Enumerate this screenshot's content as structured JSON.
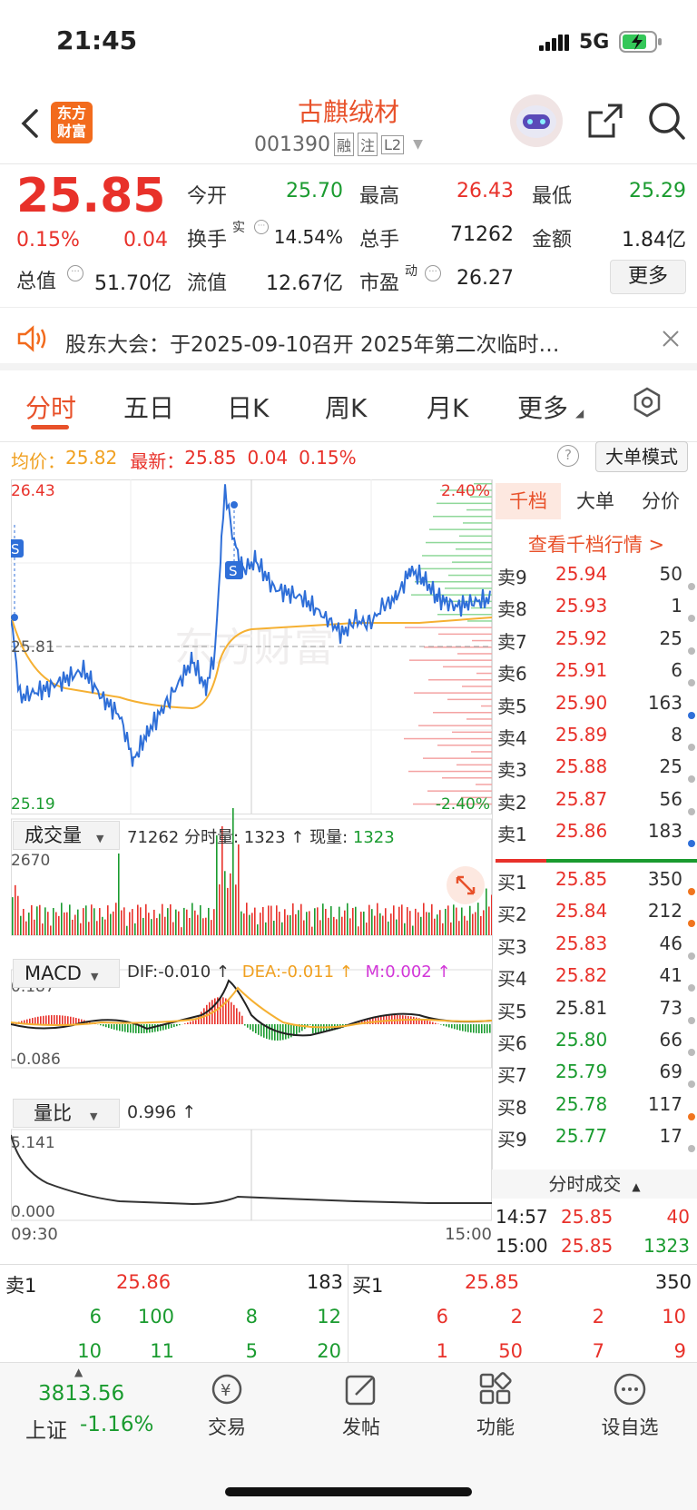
{
  "status": {
    "time": "21:45",
    "network": "5G"
  },
  "header": {
    "title": "古麒绒材",
    "code": "001390",
    "tags": [
      "融",
      "注",
      "L2"
    ],
    "logo_line1": "东方",
    "logo_line2": "财富"
  },
  "quote": {
    "price": "25.85",
    "pct": "0.15%",
    "change": "0.04",
    "open_label": "今开",
    "open": "25.70",
    "high_label": "最高",
    "high": "26.43",
    "low_label": "最低",
    "low": "25.29",
    "turnover_label": "换手",
    "turnover_sup": "实",
    "turnover": "14.54%",
    "volume_label": "总手",
    "volume": "71262",
    "amount_label": "金额",
    "amount": "1.84亿",
    "mktcap_label": "总值",
    "mktcap": "51.70亿",
    "float_label": "流值",
    "float": "12.67亿",
    "pe_label": "市盈",
    "pe_sup": "动",
    "pe": "26.27",
    "more": "更多"
  },
  "notice": {
    "text": "股东大会：于2025-09-10召开 2025年第二次临时…"
  },
  "tabs": [
    "分时",
    "五日",
    "日K",
    "周K",
    "月K",
    "更多"
  ],
  "info": {
    "avg_label": "均价：",
    "avg": "25.82",
    "last_label": "最新：",
    "last": "25.85",
    "chg": "0.04",
    "pct": "0.15%",
    "mode": "大单模式"
  },
  "chart": {
    "y_top": "26.43",
    "y_mid": "25.81",
    "y_bot": "25.19",
    "pct_top": "2.40%",
    "pct_bot": "-2.40%",
    "watermark": "东方财富",
    "s_mark": "S"
  },
  "volume": {
    "label": "成交量",
    "text1": "71262 分时量: 1323 ↑ 现量:",
    "now": "1323",
    "max": "2670"
  },
  "macd": {
    "label": "MACD",
    "dif": "DIF:-0.010 ↑",
    "dea": "DEA:-0.011 ↑",
    "m": "M:0.002 ↑",
    "top": "0.187",
    "bot": "-0.086"
  },
  "ratio": {
    "label": "量比",
    "value": "0.996 ↑",
    "top": "5.141",
    "bot": "0.000"
  },
  "time_axis": {
    "start": "09:30",
    "end": "15:00"
  },
  "depth_tabs": [
    "千档",
    "大单",
    "分价"
  ],
  "depth_link": "查看千档行情 >",
  "asks": [
    {
      "label": "卖9",
      "price": "25.94",
      "vol": "50",
      "dot": "#bbbbbb"
    },
    {
      "label": "卖8",
      "price": "25.93",
      "vol": "1",
      "dot": "#bbbbbb"
    },
    {
      "label": "卖7",
      "price": "25.92",
      "vol": "25",
      "dot": "#bbbbbb"
    },
    {
      "label": "卖6",
      "price": "25.91",
      "vol": "6",
      "dot": "#bbbbbb"
    },
    {
      "label": "卖5",
      "price": "25.90",
      "vol": "163",
      "dot": "#2f6fd8"
    },
    {
      "label": "卖4",
      "price": "25.89",
      "vol": "8",
      "dot": "#bbbbbb"
    },
    {
      "label": "卖3",
      "price": "25.88",
      "vol": "25",
      "dot": "#bbbbbb"
    },
    {
      "label": "卖2",
      "price": "25.87",
      "vol": "56",
      "dot": "#bbbbbb"
    },
    {
      "label": "卖1",
      "price": "25.86",
      "vol": "183",
      "dot": "#2f6fd8"
    }
  ],
  "bids": [
    {
      "label": "买1",
      "price": "25.85",
      "vol": "350",
      "dot": "#f0741e",
      "color": "#e8312a"
    },
    {
      "label": "买2",
      "price": "25.84",
      "vol": "212",
      "dot": "#f0741e",
      "color": "#e8312a"
    },
    {
      "label": "买3",
      "price": "25.83",
      "vol": "46",
      "dot": "#bbbbbb",
      "color": "#e8312a"
    },
    {
      "label": "买4",
      "price": "25.82",
      "vol": "41",
      "dot": "#bbbbbb",
      "color": "#e8312a"
    },
    {
      "label": "买5",
      "price": "25.81",
      "vol": "73",
      "dot": "#bbbbbb",
      "color": "#333333"
    },
    {
      "label": "买6",
      "price": "25.80",
      "vol": "66",
      "dot": "#bbbbbb",
      "color": "#1a9b2f"
    },
    {
      "label": "买7",
      "price": "25.79",
      "vol": "69",
      "dot": "#bbbbbb",
      "color": "#1a9b2f"
    },
    {
      "label": "买8",
      "price": "25.78",
      "vol": "117",
      "dot": "#f0741e",
      "color": "#1a9b2f"
    },
    {
      "label": "买9",
      "price": "25.77",
      "vol": "17",
      "dot": "#bbbbbb",
      "color": "#1a9b2f"
    }
  ],
  "ticks": {
    "label": "分时成交",
    "rows": [
      {
        "time": "14:57",
        "price": "25.85",
        "vol": "40"
      },
      {
        "time": "15:00",
        "price": "25.85",
        "vol": "1323"
      }
    ]
  },
  "bottom_book": {
    "ask_label": "卖1",
    "ask_price": "25.86",
    "ask_vol": "183",
    "bid_label": "买1",
    "bid_price": "25.85",
    "bid_vol": "350",
    "ask_row1": [
      "6",
      "100",
      "8",
      "12"
    ],
    "ask_row2": [
      "10",
      "11",
      "5",
      "20"
    ],
    "bid_row1": [
      "6",
      "2",
      "2",
      "10"
    ],
    "bid_row2": [
      "1",
      "50",
      "7",
      "9"
    ]
  },
  "index": {
    "value": "3813.56",
    "name": "上证",
    "pct": "-1.16%"
  },
  "nav": [
    "交易",
    "发帖",
    "功能",
    "设自选"
  ]
}
